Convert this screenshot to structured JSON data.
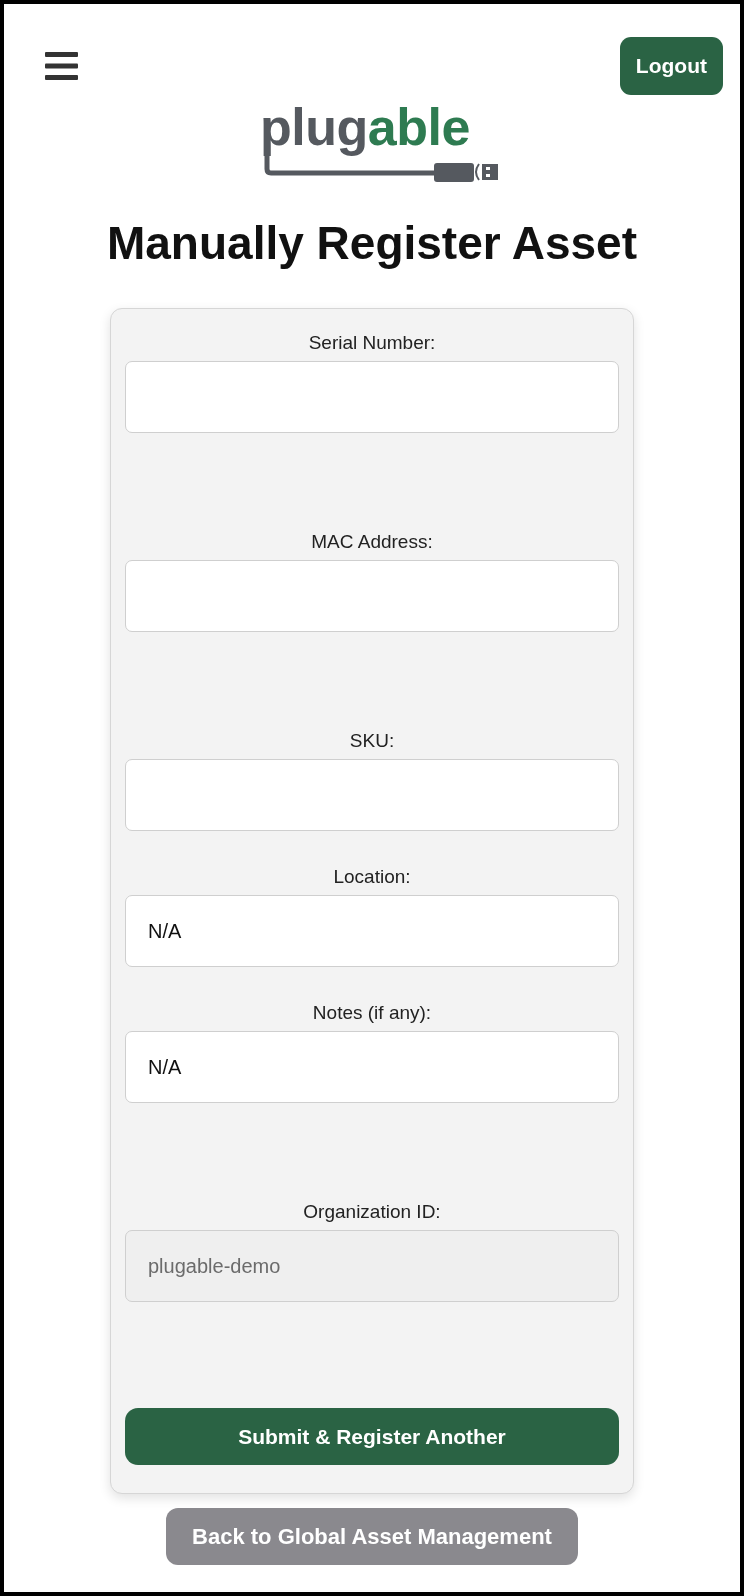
{
  "header": {
    "logout_button": "Logout"
  },
  "logo": {
    "parts": [
      {
        "text": "plug",
        "accent": false
      },
      {
        "text": "able",
        "accent": true
      }
    ]
  },
  "title": "Manually Register Asset",
  "form": {
    "fields": [
      {
        "label": "Serial Number:",
        "disabled": false
      },
      {
        "label": "MAC Address:",
        "disabled": false
      },
      {
        "label": "SKU:",
        "disabled": false
      },
      {
        "label": "Location:",
        "value": "N/A",
        "disabled": false
      },
      {
        "label": "Notes (if any):",
        "value": "N/A",
        "disabled": false
      },
      {
        "label": "Organization ID:",
        "value": "plugable-demo",
        "disabled": true
      }
    ],
    "submit_button": "Submit & Register Another"
  },
  "back_button": "Back to Global Asset Management"
}
